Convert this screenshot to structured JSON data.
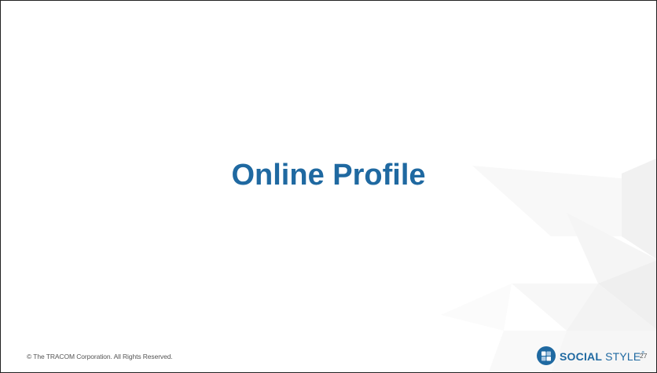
{
  "slide": {
    "title": "Online Profile",
    "copyright": "© The TRACOM Corporation. All Rights Reserved.",
    "page_number": "27"
  },
  "logo": {
    "word_bold": "SOCIAL",
    "word_light": "STYLE",
    "trademark": "®",
    "icon": "social-style-emblem-icon"
  },
  "colors": {
    "title": "#1f69a1",
    "logo": "#1f69a1",
    "footer_text": "#555555",
    "background_pattern": "#f3f3f3"
  }
}
